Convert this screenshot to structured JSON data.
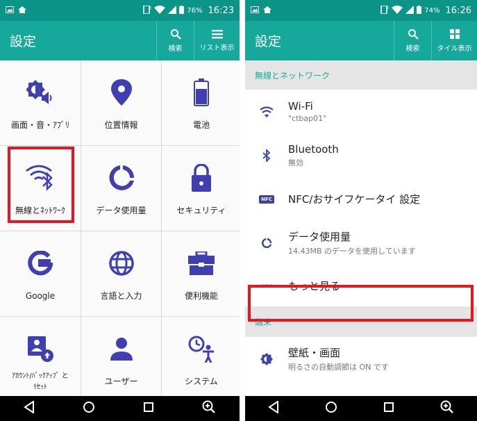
{
  "left": {
    "status": {
      "battery": "76%",
      "time": "16:23"
    },
    "appbar": {
      "title": "設定",
      "search_label": "検索",
      "view_label": "リスト表示"
    },
    "grid": [
      {
        "label": "画面・音・ｱﾌﾟﾘ",
        "icon": "brightness-sound-icon"
      },
      {
        "label": "位置情報",
        "icon": "location-pin-icon"
      },
      {
        "label": "電池",
        "icon": "battery-icon"
      },
      {
        "label": "無線とﾈｯﾄﾜｰｸ",
        "icon": "wifi-bluetooth-icon"
      },
      {
        "label": "データ使用量",
        "icon": "data-usage-icon"
      },
      {
        "label": "セキュリティ",
        "icon": "lock-icon"
      },
      {
        "label": "Google",
        "icon": "google-icon"
      },
      {
        "label": "言語と入力",
        "icon": "globe-icon"
      },
      {
        "label": "便利機能",
        "icon": "toolbox-icon"
      },
      {
        "label": "ｱｶｳﾝﾄ/ﾊﾞｯｸｱｯﾌﾟ と ﾘｾｯﾄ",
        "icon": "account-backup-icon"
      },
      {
        "label": "ユーザー",
        "icon": "user-icon"
      },
      {
        "label": "システム",
        "icon": "system-icon"
      }
    ]
  },
  "right": {
    "status": {
      "battery": "74%",
      "time": "16:26"
    },
    "appbar": {
      "title": "設定",
      "search_label": "検索",
      "view_label": "タイル表示"
    },
    "sections": [
      {
        "header": "無線とネットワーク",
        "items": [
          {
            "title": "Wi-Fi",
            "subtitle": "\"ctbap01\"",
            "icon": "wifi-icon"
          },
          {
            "title": "Bluetooth",
            "subtitle": "無効",
            "icon": "bluetooth-icon"
          },
          {
            "title": "NFC/おサイフケータイ 設定",
            "subtitle": "",
            "icon": "nfc-icon",
            "badge": "NFC"
          },
          {
            "title": "データ使用量",
            "subtitle": "14.43MB のデータを使用しています",
            "icon": "data-usage-icon"
          },
          {
            "title": "もっと見る",
            "subtitle": "",
            "icon": "more-icon"
          }
        ]
      },
      {
        "header": "端末",
        "items": [
          {
            "title": "壁紙・画面",
            "subtitle": "明るさの自動調節は ON です",
            "icon": "brightness-icon"
          }
        ]
      }
    ]
  },
  "colors": {
    "statusbar": "#0b9488",
    "appbar": "#16a99b",
    "icon": "#3f3fb0",
    "highlight": "#e8141e"
  }
}
